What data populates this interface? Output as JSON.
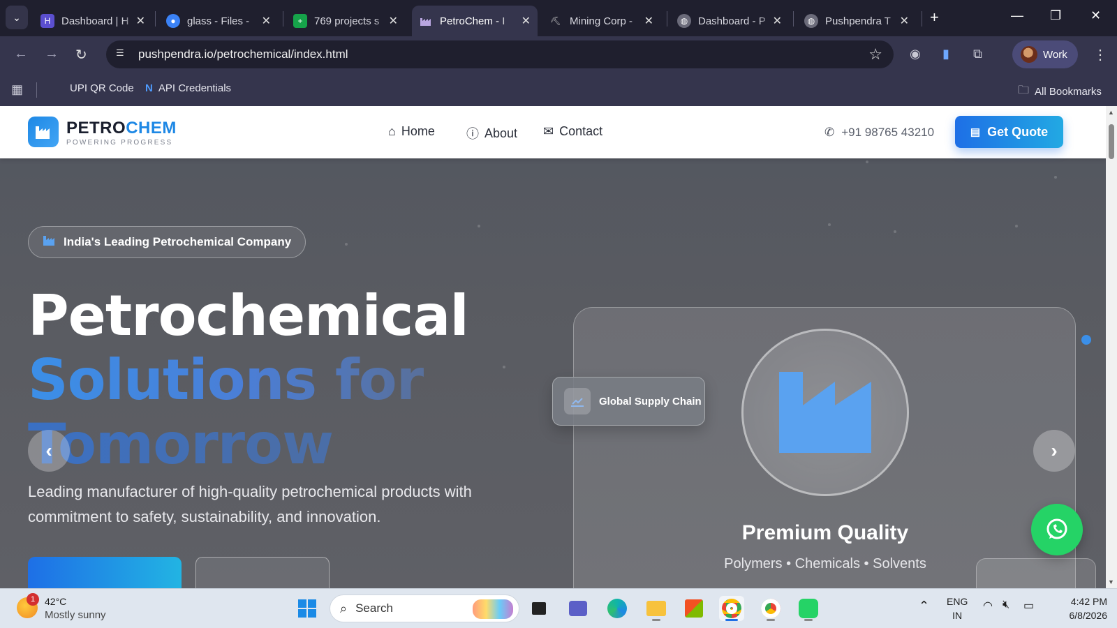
{
  "browser": {
    "tabs": [
      {
        "title": "Dashboard | H",
        "favicon_color": "#5b4fcf",
        "icon": "hash-icon"
      },
      {
        "title": "glass - Files - ",
        "favicon_color": "#3b82f6",
        "icon": "files-icon"
      },
      {
        "title": "769 projects s",
        "favicon_color": "#16a34a",
        "icon": "projects-icon"
      },
      {
        "title": "PetroChem - I",
        "favicon_color": "#b46cbf",
        "icon": "factory-icon",
        "active": true
      },
      {
        "title": "Mining Corp - ",
        "favicon_color": "#8a8a8a",
        "icon": "pickaxe-icon"
      },
      {
        "title": "Dashboard - P",
        "favicon_color": "#6b6b7a",
        "icon": "globe-icon"
      },
      {
        "title": "Pushpendra T",
        "favicon_color": "#6b6b7a",
        "icon": "globe-icon"
      }
    ],
    "url": "pushpendra.io/petrochemical/index.html",
    "profile_label": "Work",
    "bookmarks": [
      {
        "label": "UPI QR Code"
      },
      {
        "label": "API Credentials"
      }
    ],
    "all_bookmarks_label": "All Bookmarks"
  },
  "site": {
    "logo": {
      "part1": "PETRO",
      "part2": "CHEM",
      "tagline": "POWERING PROGRESS"
    },
    "nav": [
      {
        "label": "Home",
        "icon": "home-icon"
      },
      {
        "label": "About",
        "icon": "info-icon"
      },
      {
        "label": "Contact",
        "icon": "envelope-icon"
      }
    ],
    "phone": "+91 98765 43210",
    "quote_label": "Get Quote",
    "accent": "#1e88e5"
  },
  "hero": {
    "badge": "India's Leading Petrochemical Company",
    "title_line1": "Petrochemical",
    "title_line2": "Solutions for",
    "title_line3": "Tomorrow",
    "subtitle": "Leading manufacturer of high-quality petrochemical products with commitment to safety, sustainability, and innovation."
  },
  "card": {
    "title": "Premium Quality",
    "subtitle": "Polymers • Chemicals • Solvents",
    "floating_tag": "Global Supply Chain"
  },
  "taskbar": {
    "weather_temp": "42°C",
    "weather_cond": "Mostly sunny",
    "weather_badge": "1",
    "search_placeholder": "Search",
    "lang_line1": "ENG",
    "lang_line2": "IN",
    "time": "4:42 PM",
    "date": "6/8/2026"
  }
}
